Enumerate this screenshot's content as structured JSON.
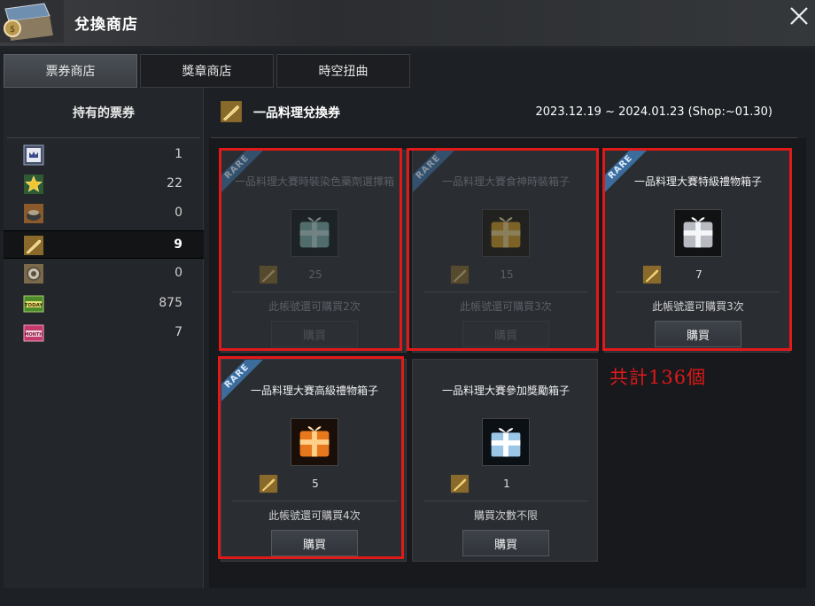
{
  "window": {
    "title": "兌換商店"
  },
  "tabs": [
    {
      "label": "票券商店",
      "active": true
    },
    {
      "label": "獎章商店",
      "active": false
    },
    {
      "label": "時空扭曲",
      "active": false
    }
  ],
  "sidebar": {
    "title": "持有的票券",
    "tickets": [
      {
        "icon": "crown-ticket-icon",
        "count": "1"
      },
      {
        "icon": "star-ticket-icon",
        "count": "22"
      },
      {
        "icon": "cooking-pot-ticket-icon",
        "count": "0"
      },
      {
        "icon": "golden-spatula-ticket-icon",
        "count": "9",
        "selected": true
      },
      {
        "icon": "gear-ticket-icon",
        "count": "0"
      },
      {
        "icon": "today-ticket-icon",
        "count": "875"
      },
      {
        "icon": "month-ticket-icon",
        "count": "7"
      }
    ]
  },
  "header": {
    "title": "一品料理兌換券",
    "dates": "2023.12.19 ~ 2024.01.23 (Shop:~01.30)"
  },
  "items": [
    {
      "rare_label": "RARE",
      "name": "一品料理大賽時裝染色藥劑選擇箱",
      "icon": "teal-gift-box-icon",
      "cost": "25",
      "limit": "此帳號還可購買2次",
      "buy": "購買",
      "available": false
    },
    {
      "rare_label": "RARE",
      "name": "一品料理大賽食神時裝箱子",
      "icon": "gold-gift-box-icon",
      "cost": "15",
      "limit": "此帳號還可購買3次",
      "buy": "購買",
      "available": false
    },
    {
      "rare_label": "RARE",
      "name": "一品料理大賽特級禮物箱子",
      "icon": "silver-gift-box-icon",
      "cost": "7",
      "limit": "此帳號還可購買3次",
      "buy": "購買",
      "available": true
    },
    {
      "rare_label": "RARE",
      "name": "一品料理大賽高級禮物箱子",
      "icon": "orange-gift-box-icon",
      "cost": "5",
      "limit": "此帳號還可購買4次",
      "buy": "購買",
      "available": true
    },
    {
      "rare_label": "",
      "name": "一品料理大賽參加獎勵箱子",
      "icon": "blue-gift-box-icon",
      "cost": "1",
      "limit": "購買次數不限",
      "buy": "購買",
      "available": true
    }
  ],
  "annotation": {
    "text": "共計136個",
    "color": "#e01919"
  }
}
